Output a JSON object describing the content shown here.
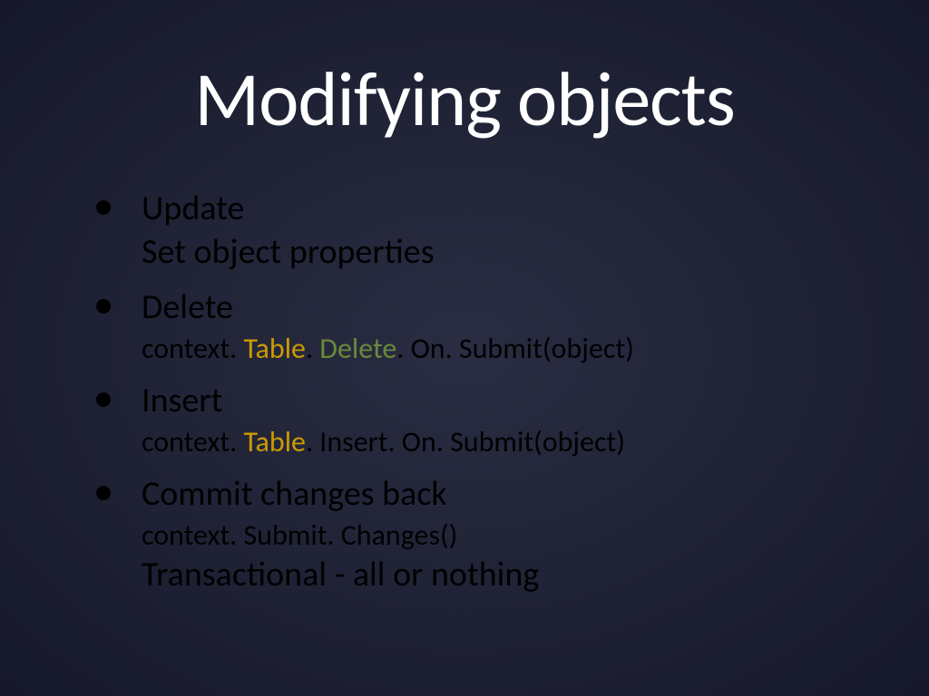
{
  "title": "Modifying objects",
  "bullets": [
    {
      "heading": "Update",
      "sub": "Set object properties",
      "code": null
    },
    {
      "heading": "Delete",
      "sub": null,
      "code": {
        "pre": "context. ",
        "mid": "Table",
        "post1": ". ",
        "accent": "Delete",
        "post2": ". On. Submit(object)"
      }
    },
    {
      "heading": "Insert",
      "sub": null,
      "code": {
        "pre": "context. ",
        "mid": "Table",
        "post1": ". Insert. On. Submit(object)",
        "accent": null,
        "post2": ""
      }
    },
    {
      "heading": "Commit changes back",
      "sub": "Transactional - all or nothing",
      "subAfterCode": true,
      "code": {
        "pre": "context. Submit. Changes()",
        "mid": null,
        "post1": "",
        "accent": null,
        "post2": ""
      }
    }
  ]
}
